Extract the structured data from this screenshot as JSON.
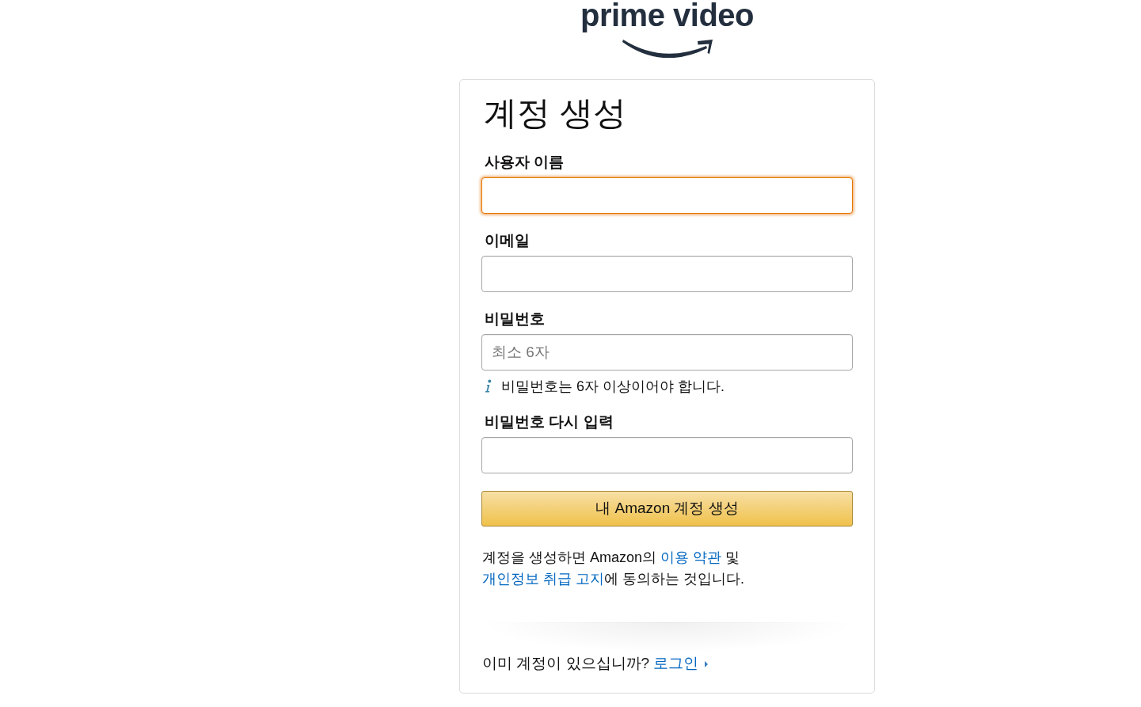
{
  "logo": {
    "wordmark": "prime video"
  },
  "form": {
    "title": "계정 생성",
    "fields": [
      {
        "label": "사용자 이름",
        "focused": true
      },
      {
        "label": "이메일",
        "focused": false
      },
      {
        "label": "비밀번호",
        "focused": false,
        "placeholder": "최소 6자",
        "hint": "비밀번호는 6자 이상이어야 합니다."
      },
      {
        "label": "비밀번호 다시 입력",
        "focused": false
      }
    ],
    "submit_button": {
      "label": "내 Amazon 계정 생성"
    },
    "legal_notice": [
      {
        "kind": "text",
        "text": "계정을 생성하면 Amazon의 "
      },
      {
        "kind": "link",
        "text": "이용 약관"
      },
      {
        "kind": "text",
        "text": " 및 "
      },
      {
        "kind": "link",
        "text": "개인정보 취급 고지"
      },
      {
        "kind": "text",
        "text": "에 동의하는 것입니다."
      }
    ],
    "sign_in": {
      "question": "이미 계정이 있으십니까?",
      "link": "로그인"
    }
  }
}
